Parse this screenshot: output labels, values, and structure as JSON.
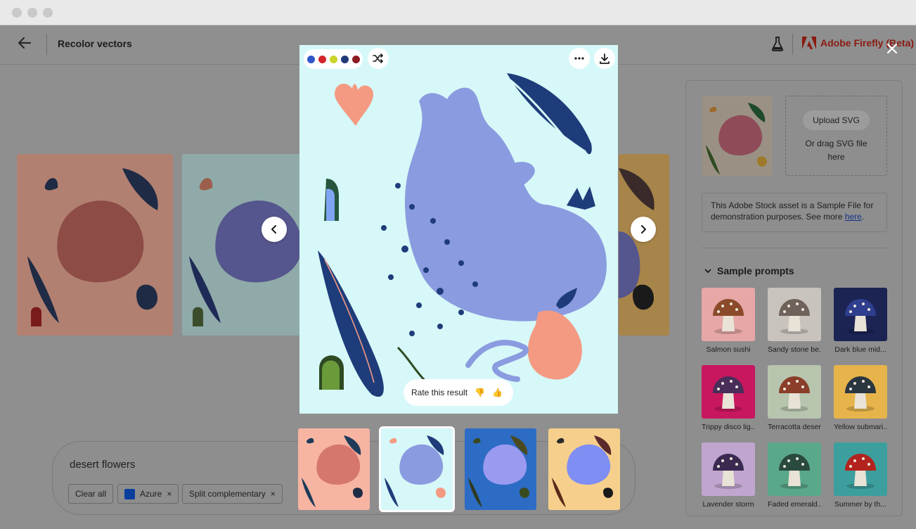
{
  "window": {
    "buttons": [
      "close",
      "minimize",
      "zoom"
    ]
  },
  "header": {
    "back_icon": "arrow-left-icon",
    "title": "Recolor vectors",
    "flask_icon": "flask-icon",
    "brand": "Adobe Firefly (Beta)"
  },
  "modal": {
    "close_icon": "close-icon",
    "palette": [
      "#2f57c9",
      "#d3262a",
      "#c9d52a",
      "#1e3a78",
      "#8b1d22"
    ],
    "shuffle_icon": "shuffle-icon",
    "more_icon": "more-icon",
    "download_icon": "download-icon",
    "rate_label": "Rate this result",
    "thumbs_down": "👎",
    "thumbs_up": "👍",
    "prev_icon": "chevron-left-icon",
    "next_icon": "chevron-right-icon",
    "selected_variant": 2
  },
  "panel": {
    "upload_button": "Upload SVG",
    "drag_text": "Or drag SVG file here",
    "notice_text": "This Adobe Stock asset is a Sample File for demonstration purposes. See more",
    "notice_link": "here",
    "notice_end": ".",
    "sample_prompts_title": "Sample prompts",
    "sample_prompts": [
      {
        "label": "Salmon sushi",
        "bg": "#e6a7a6",
        "cap": "#8b4a2a"
      },
      {
        "label": "Sandy stone be...",
        "bg": "#c9c3bd",
        "cap": "#6e625a"
      },
      {
        "label": "Dark blue mid...",
        "bg": "#1c2454",
        "cap": "#2f3e8e"
      },
      {
        "label": "Trippy disco lig...",
        "bg": "#c8175e",
        "cap": "#4a2e5a"
      },
      {
        "label": "Terracotta desert",
        "bg": "#b7c5ae",
        "cap": "#8b3e2a"
      },
      {
        "label": "Yellow submari...",
        "bg": "#e6b44a",
        "cap": "#2a3640"
      },
      {
        "label": "Lavender storm",
        "bg": "#c0a6cf",
        "cap": "#3a2a50"
      },
      {
        "label": "Faded emerald...",
        "bg": "#5aa88a",
        "cap": "#2a4a3e"
      },
      {
        "label": "Summer by th...",
        "bg": "#3c9f9e",
        "cap": "#b2231e"
      }
    ]
  },
  "prompt": {
    "text": "desert flowers",
    "chips": [
      {
        "label": "Clear all"
      },
      {
        "label": "Azure",
        "swatch": "#0a3f9e",
        "remove": "×"
      },
      {
        "label": "Split complementary",
        "remove": "×"
      }
    ]
  }
}
